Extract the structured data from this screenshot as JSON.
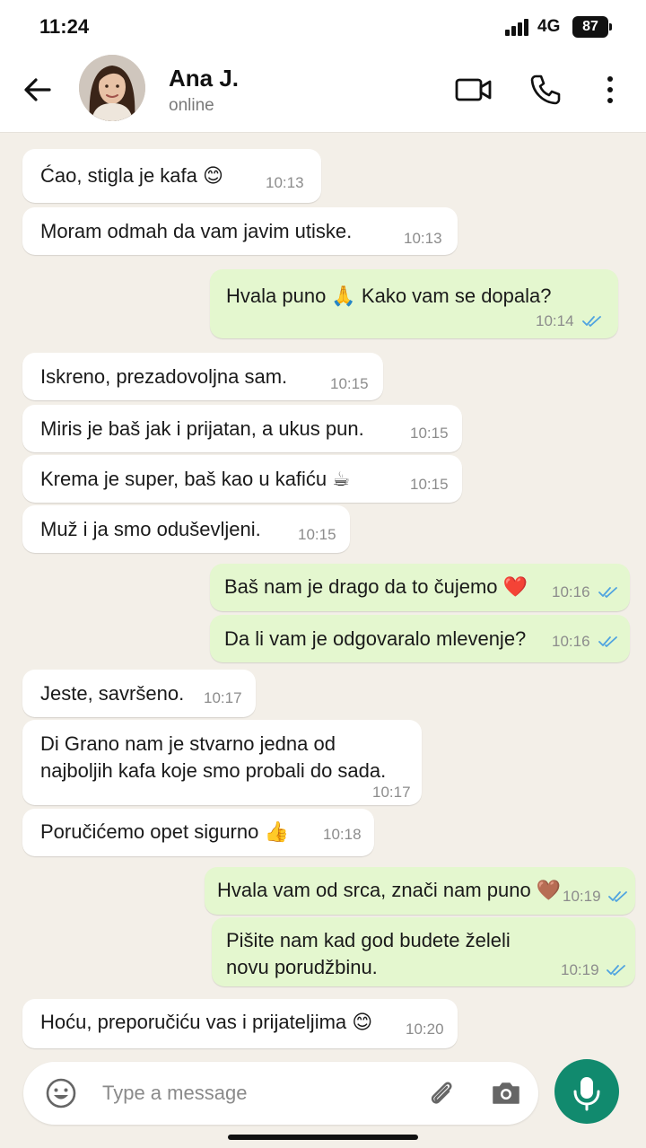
{
  "status_bar": {
    "time": "11:24",
    "network": "4G",
    "battery": "87"
  },
  "header": {
    "name": "Ana J.",
    "status": "online"
  },
  "messages": [
    {
      "dir": "in",
      "text": "Ćao, stigla je kafa 😊",
      "time": "10:13"
    },
    {
      "dir": "in",
      "text": "Moram odmah da vam javim utiske.",
      "time": "10:13"
    },
    {
      "dir": "out",
      "text": "Hvala puno 🙏 Kako vam se dopala?",
      "time": "10:14"
    },
    {
      "dir": "in",
      "text": "Iskreno, prezadovoljna sam.",
      "time": "10:15"
    },
    {
      "dir": "in",
      "text": "Miris je baš jak i prijatan, a ukus pun.",
      "time": "10:15"
    },
    {
      "dir": "in",
      "text": "Krema je super, baš kao u kafiću ☕",
      "time": "10:15"
    },
    {
      "dir": "in",
      "text": "Muž i ja smo oduševljeni.",
      "time": "10:15"
    },
    {
      "dir": "out",
      "text": "Baš nam je drago da to čujemo ❤️",
      "time": "10:16"
    },
    {
      "dir": "out",
      "text": "Da li vam je odgovaralo mlevenje?",
      "time": "10:16"
    },
    {
      "dir": "in",
      "text": "Jeste, savršeno.",
      "time": "10:17"
    },
    {
      "dir": "in",
      "text": "Di Grano nam je stvarno jedna od najboljih kafa koje smo probali do sada.",
      "time": "10:17"
    },
    {
      "dir": "in",
      "text": "Poručićemo opet sigurno 👍",
      "time": "10:18"
    },
    {
      "dir": "out",
      "text": "Hvala vam od srca, znači nam puno 🤎",
      "time": "10:19"
    },
    {
      "dir": "out",
      "text": "Pišite nam kad god budete želeli novu porudžbinu.",
      "time": "10:19"
    },
    {
      "dir": "in",
      "text": "Hoću, preporučiću vas i prijateljima 😊",
      "time": "10:20"
    }
  ],
  "composer": {
    "placeholder": "Type a message"
  },
  "colors": {
    "accent": "#118a6e",
    "outgoing_bubble": "#e4f7cf",
    "read_ticks": "#4fa3e0"
  },
  "icons": [
    "back-arrow-icon",
    "video-icon",
    "phone-icon",
    "more-vert-icon",
    "emoji-icon",
    "paperclip-icon",
    "camera-icon",
    "mic-icon"
  ]
}
